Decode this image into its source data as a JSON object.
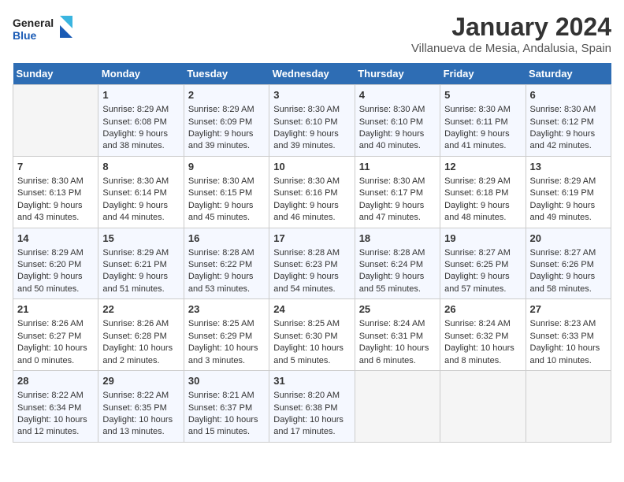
{
  "logo": {
    "line1": "General",
    "line2": "Blue"
  },
  "title": "January 2024",
  "subtitle": "Villanueva de Mesia, Andalusia, Spain",
  "columns": [
    "Sunday",
    "Monday",
    "Tuesday",
    "Wednesday",
    "Thursday",
    "Friday",
    "Saturday"
  ],
  "weeks": [
    [
      {
        "num": "",
        "empty": true,
        "lines": []
      },
      {
        "num": "1",
        "empty": false,
        "lines": [
          "Sunrise: 8:29 AM",
          "Sunset: 6:08 PM",
          "Daylight: 9 hours",
          "and 38 minutes."
        ]
      },
      {
        "num": "2",
        "empty": false,
        "lines": [
          "Sunrise: 8:29 AM",
          "Sunset: 6:09 PM",
          "Daylight: 9 hours",
          "and 39 minutes."
        ]
      },
      {
        "num": "3",
        "empty": false,
        "lines": [
          "Sunrise: 8:30 AM",
          "Sunset: 6:10 PM",
          "Daylight: 9 hours",
          "and 39 minutes."
        ]
      },
      {
        "num": "4",
        "empty": false,
        "lines": [
          "Sunrise: 8:30 AM",
          "Sunset: 6:10 PM",
          "Daylight: 9 hours",
          "and 40 minutes."
        ]
      },
      {
        "num": "5",
        "empty": false,
        "lines": [
          "Sunrise: 8:30 AM",
          "Sunset: 6:11 PM",
          "Daylight: 9 hours",
          "and 41 minutes."
        ]
      },
      {
        "num": "6",
        "empty": false,
        "lines": [
          "Sunrise: 8:30 AM",
          "Sunset: 6:12 PM",
          "Daylight: 9 hours",
          "and 42 minutes."
        ]
      }
    ],
    [
      {
        "num": "7",
        "empty": false,
        "lines": [
          "Sunrise: 8:30 AM",
          "Sunset: 6:13 PM",
          "Daylight: 9 hours",
          "and 43 minutes."
        ]
      },
      {
        "num": "8",
        "empty": false,
        "lines": [
          "Sunrise: 8:30 AM",
          "Sunset: 6:14 PM",
          "Daylight: 9 hours",
          "and 44 minutes."
        ]
      },
      {
        "num": "9",
        "empty": false,
        "lines": [
          "Sunrise: 8:30 AM",
          "Sunset: 6:15 PM",
          "Daylight: 9 hours",
          "and 45 minutes."
        ]
      },
      {
        "num": "10",
        "empty": false,
        "lines": [
          "Sunrise: 8:30 AM",
          "Sunset: 6:16 PM",
          "Daylight: 9 hours",
          "and 46 minutes."
        ]
      },
      {
        "num": "11",
        "empty": false,
        "lines": [
          "Sunrise: 8:30 AM",
          "Sunset: 6:17 PM",
          "Daylight: 9 hours",
          "and 47 minutes."
        ]
      },
      {
        "num": "12",
        "empty": false,
        "lines": [
          "Sunrise: 8:29 AM",
          "Sunset: 6:18 PM",
          "Daylight: 9 hours",
          "and 48 minutes."
        ]
      },
      {
        "num": "13",
        "empty": false,
        "lines": [
          "Sunrise: 8:29 AM",
          "Sunset: 6:19 PM",
          "Daylight: 9 hours",
          "and 49 minutes."
        ]
      }
    ],
    [
      {
        "num": "14",
        "empty": false,
        "lines": [
          "Sunrise: 8:29 AM",
          "Sunset: 6:20 PM",
          "Daylight: 9 hours",
          "and 50 minutes."
        ]
      },
      {
        "num": "15",
        "empty": false,
        "lines": [
          "Sunrise: 8:29 AM",
          "Sunset: 6:21 PM",
          "Daylight: 9 hours",
          "and 51 minutes."
        ]
      },
      {
        "num": "16",
        "empty": false,
        "lines": [
          "Sunrise: 8:28 AM",
          "Sunset: 6:22 PM",
          "Daylight: 9 hours",
          "and 53 minutes."
        ]
      },
      {
        "num": "17",
        "empty": false,
        "lines": [
          "Sunrise: 8:28 AM",
          "Sunset: 6:23 PM",
          "Daylight: 9 hours",
          "and 54 minutes."
        ]
      },
      {
        "num": "18",
        "empty": false,
        "lines": [
          "Sunrise: 8:28 AM",
          "Sunset: 6:24 PM",
          "Daylight: 9 hours",
          "and 55 minutes."
        ]
      },
      {
        "num": "19",
        "empty": false,
        "lines": [
          "Sunrise: 8:27 AM",
          "Sunset: 6:25 PM",
          "Daylight: 9 hours",
          "and 57 minutes."
        ]
      },
      {
        "num": "20",
        "empty": false,
        "lines": [
          "Sunrise: 8:27 AM",
          "Sunset: 6:26 PM",
          "Daylight: 9 hours",
          "and 58 minutes."
        ]
      }
    ],
    [
      {
        "num": "21",
        "empty": false,
        "lines": [
          "Sunrise: 8:26 AM",
          "Sunset: 6:27 PM",
          "Daylight: 10 hours",
          "and 0 minutes."
        ]
      },
      {
        "num": "22",
        "empty": false,
        "lines": [
          "Sunrise: 8:26 AM",
          "Sunset: 6:28 PM",
          "Daylight: 10 hours",
          "and 2 minutes."
        ]
      },
      {
        "num": "23",
        "empty": false,
        "lines": [
          "Sunrise: 8:25 AM",
          "Sunset: 6:29 PM",
          "Daylight: 10 hours",
          "and 3 minutes."
        ]
      },
      {
        "num": "24",
        "empty": false,
        "lines": [
          "Sunrise: 8:25 AM",
          "Sunset: 6:30 PM",
          "Daylight: 10 hours",
          "and 5 minutes."
        ]
      },
      {
        "num": "25",
        "empty": false,
        "lines": [
          "Sunrise: 8:24 AM",
          "Sunset: 6:31 PM",
          "Daylight: 10 hours",
          "and 6 minutes."
        ]
      },
      {
        "num": "26",
        "empty": false,
        "lines": [
          "Sunrise: 8:24 AM",
          "Sunset: 6:32 PM",
          "Daylight: 10 hours",
          "and 8 minutes."
        ]
      },
      {
        "num": "27",
        "empty": false,
        "lines": [
          "Sunrise: 8:23 AM",
          "Sunset: 6:33 PM",
          "Daylight: 10 hours",
          "and 10 minutes."
        ]
      }
    ],
    [
      {
        "num": "28",
        "empty": false,
        "lines": [
          "Sunrise: 8:22 AM",
          "Sunset: 6:34 PM",
          "Daylight: 10 hours",
          "and 12 minutes."
        ]
      },
      {
        "num": "29",
        "empty": false,
        "lines": [
          "Sunrise: 8:22 AM",
          "Sunset: 6:35 PM",
          "Daylight: 10 hours",
          "and 13 minutes."
        ]
      },
      {
        "num": "30",
        "empty": false,
        "lines": [
          "Sunrise: 8:21 AM",
          "Sunset: 6:37 PM",
          "Daylight: 10 hours",
          "and 15 minutes."
        ]
      },
      {
        "num": "31",
        "empty": false,
        "lines": [
          "Sunrise: 8:20 AM",
          "Sunset: 6:38 PM",
          "Daylight: 10 hours",
          "and 17 minutes."
        ]
      },
      {
        "num": "",
        "empty": true,
        "lines": []
      },
      {
        "num": "",
        "empty": true,
        "lines": []
      },
      {
        "num": "",
        "empty": true,
        "lines": []
      }
    ]
  ]
}
